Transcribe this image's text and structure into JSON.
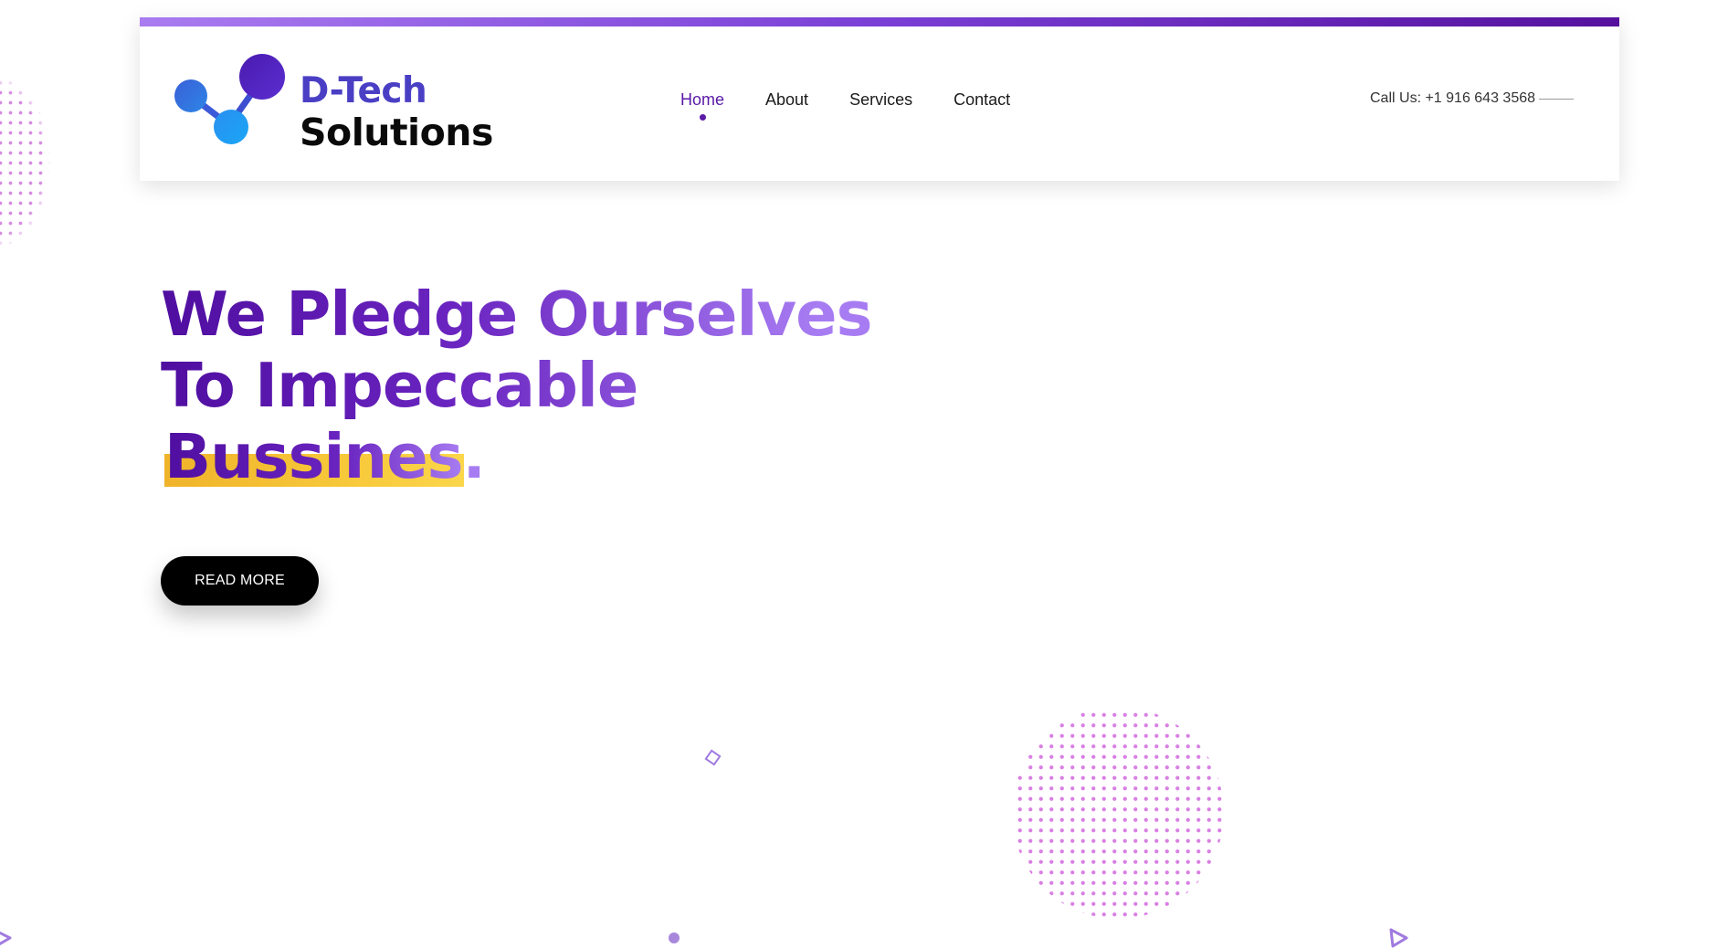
{
  "brand": {
    "name_line1": "D-Tech",
    "name_line2": "Solutions",
    "accent_color": "#5a1aa6",
    "logo_blue": "#4a3fc4"
  },
  "nav": {
    "items": [
      {
        "label": "Home",
        "active": true
      },
      {
        "label": "About",
        "active": false
      },
      {
        "label": "Services",
        "active": false
      },
      {
        "label": "Contact",
        "active": false
      }
    ]
  },
  "header": {
    "call_us": "Call Us: +1 916 643 3568"
  },
  "hero": {
    "line1": "We Pledge Ourselves",
    "line2": "To Impeccable",
    "line3": "Bussines.",
    "highlight_color": "#f5c030",
    "cta_label": "READ MORE"
  },
  "decor": {
    "dot_pattern_color": "#d97fe3",
    "shape_color": "#a07ae0",
    "icons": [
      "diamond-icon",
      "dot-icon",
      "triangle-icon"
    ]
  }
}
